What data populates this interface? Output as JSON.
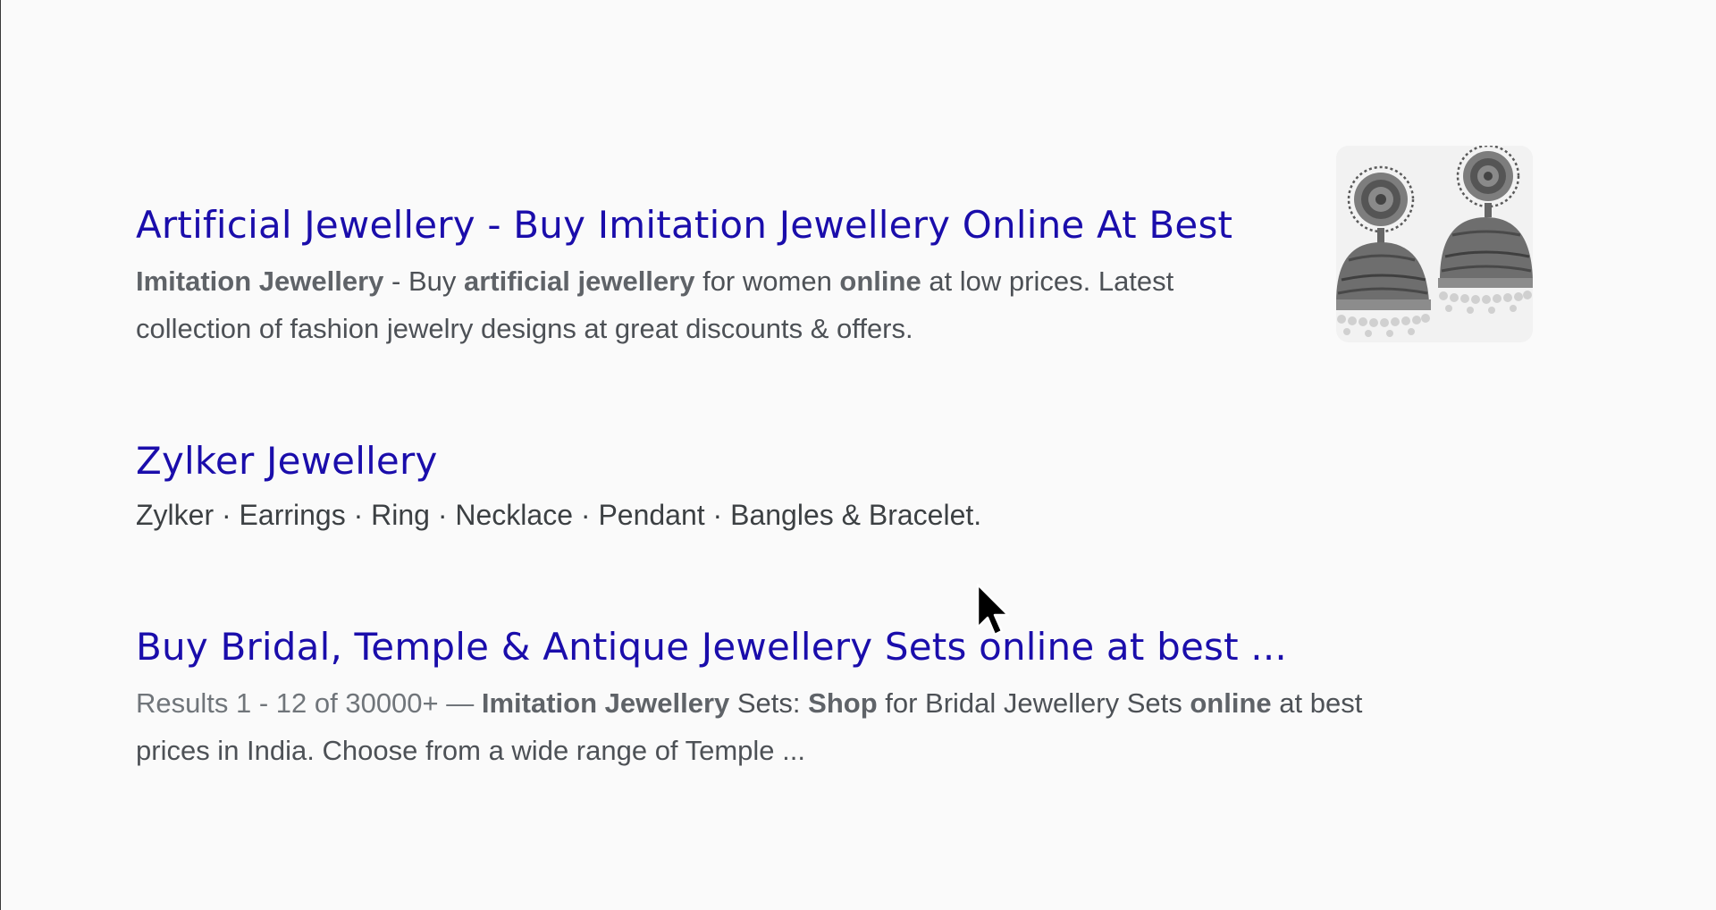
{
  "results": [
    {
      "title": "Artificial Jewellery - Buy Imitation Jewellery Online At Best",
      "snippet": {
        "s1": "Imitation Jewellery",
        "s2": " - Buy ",
        "s3": "artificial jewellery",
        "s4": " for women ",
        "s5": "online",
        "s6": " at low prices. Latest collection of fashion jewelry designs at great discounts & offers."
      },
      "thumbnail_icon": "jhumka-earrings-image"
    },
    {
      "title": "Zylker Jewellery",
      "snippet": "Zylker · Earrings · Ring · Necklace · Pendant · Bangles & Bracelet."
    },
    {
      "title": "Buy Bridal, Temple & Antique Jewellery Sets online at best ...",
      "snippet": {
        "s1": "Results 1 - 12 of 30000+ — ",
        "s2": "Imitation Jewellery",
        "s3": " Sets: ",
        "s4": "Shop",
        "s5": " for Bridal Jewellery Sets ",
        "s6": "online",
        "s7": " at best prices in India. Choose from a wide range of Temple ..."
      }
    }
  ],
  "colors": {
    "link": "#1a0dab",
    "snippet_text": "#4d5156",
    "background": "#fafafa"
  },
  "cursor_icon": "mouse-pointer-icon"
}
